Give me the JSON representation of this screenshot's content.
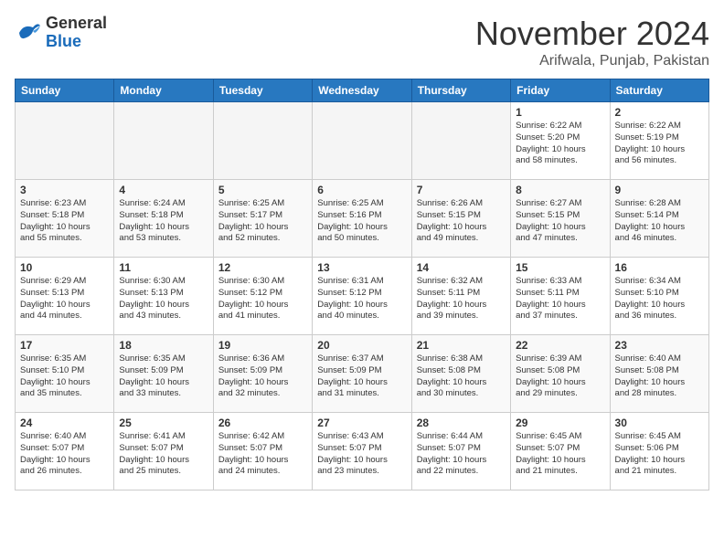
{
  "header": {
    "logo_general": "General",
    "logo_blue": "Blue",
    "month_year": "November 2024",
    "location": "Arifwala, Punjab, Pakistan"
  },
  "weekdays": [
    "Sunday",
    "Monday",
    "Tuesday",
    "Wednesday",
    "Thursday",
    "Friday",
    "Saturday"
  ],
  "weeks": [
    {
      "days": [
        {
          "num": "",
          "info": ""
        },
        {
          "num": "",
          "info": ""
        },
        {
          "num": "",
          "info": ""
        },
        {
          "num": "",
          "info": ""
        },
        {
          "num": "",
          "info": ""
        },
        {
          "num": "1",
          "info": "Sunrise: 6:22 AM\nSunset: 5:20 PM\nDaylight: 10 hours\nand 58 minutes."
        },
        {
          "num": "2",
          "info": "Sunrise: 6:22 AM\nSunset: 5:19 PM\nDaylight: 10 hours\nand 56 minutes."
        }
      ]
    },
    {
      "days": [
        {
          "num": "3",
          "info": "Sunrise: 6:23 AM\nSunset: 5:18 PM\nDaylight: 10 hours\nand 55 minutes."
        },
        {
          "num": "4",
          "info": "Sunrise: 6:24 AM\nSunset: 5:18 PM\nDaylight: 10 hours\nand 53 minutes."
        },
        {
          "num": "5",
          "info": "Sunrise: 6:25 AM\nSunset: 5:17 PM\nDaylight: 10 hours\nand 52 minutes."
        },
        {
          "num": "6",
          "info": "Sunrise: 6:25 AM\nSunset: 5:16 PM\nDaylight: 10 hours\nand 50 minutes."
        },
        {
          "num": "7",
          "info": "Sunrise: 6:26 AM\nSunset: 5:15 PM\nDaylight: 10 hours\nand 49 minutes."
        },
        {
          "num": "8",
          "info": "Sunrise: 6:27 AM\nSunset: 5:15 PM\nDaylight: 10 hours\nand 47 minutes."
        },
        {
          "num": "9",
          "info": "Sunrise: 6:28 AM\nSunset: 5:14 PM\nDaylight: 10 hours\nand 46 minutes."
        }
      ]
    },
    {
      "days": [
        {
          "num": "10",
          "info": "Sunrise: 6:29 AM\nSunset: 5:13 PM\nDaylight: 10 hours\nand 44 minutes."
        },
        {
          "num": "11",
          "info": "Sunrise: 6:30 AM\nSunset: 5:13 PM\nDaylight: 10 hours\nand 43 minutes."
        },
        {
          "num": "12",
          "info": "Sunrise: 6:30 AM\nSunset: 5:12 PM\nDaylight: 10 hours\nand 41 minutes."
        },
        {
          "num": "13",
          "info": "Sunrise: 6:31 AM\nSunset: 5:12 PM\nDaylight: 10 hours\nand 40 minutes."
        },
        {
          "num": "14",
          "info": "Sunrise: 6:32 AM\nSunset: 5:11 PM\nDaylight: 10 hours\nand 39 minutes."
        },
        {
          "num": "15",
          "info": "Sunrise: 6:33 AM\nSunset: 5:11 PM\nDaylight: 10 hours\nand 37 minutes."
        },
        {
          "num": "16",
          "info": "Sunrise: 6:34 AM\nSunset: 5:10 PM\nDaylight: 10 hours\nand 36 minutes."
        }
      ]
    },
    {
      "days": [
        {
          "num": "17",
          "info": "Sunrise: 6:35 AM\nSunset: 5:10 PM\nDaylight: 10 hours\nand 35 minutes."
        },
        {
          "num": "18",
          "info": "Sunrise: 6:35 AM\nSunset: 5:09 PM\nDaylight: 10 hours\nand 33 minutes."
        },
        {
          "num": "19",
          "info": "Sunrise: 6:36 AM\nSunset: 5:09 PM\nDaylight: 10 hours\nand 32 minutes."
        },
        {
          "num": "20",
          "info": "Sunrise: 6:37 AM\nSunset: 5:09 PM\nDaylight: 10 hours\nand 31 minutes."
        },
        {
          "num": "21",
          "info": "Sunrise: 6:38 AM\nSunset: 5:08 PM\nDaylight: 10 hours\nand 30 minutes."
        },
        {
          "num": "22",
          "info": "Sunrise: 6:39 AM\nSunset: 5:08 PM\nDaylight: 10 hours\nand 29 minutes."
        },
        {
          "num": "23",
          "info": "Sunrise: 6:40 AM\nSunset: 5:08 PM\nDaylight: 10 hours\nand 28 minutes."
        }
      ]
    },
    {
      "days": [
        {
          "num": "24",
          "info": "Sunrise: 6:40 AM\nSunset: 5:07 PM\nDaylight: 10 hours\nand 26 minutes."
        },
        {
          "num": "25",
          "info": "Sunrise: 6:41 AM\nSunset: 5:07 PM\nDaylight: 10 hours\nand 25 minutes."
        },
        {
          "num": "26",
          "info": "Sunrise: 6:42 AM\nSunset: 5:07 PM\nDaylight: 10 hours\nand 24 minutes."
        },
        {
          "num": "27",
          "info": "Sunrise: 6:43 AM\nSunset: 5:07 PM\nDaylight: 10 hours\nand 23 minutes."
        },
        {
          "num": "28",
          "info": "Sunrise: 6:44 AM\nSunset: 5:07 PM\nDaylight: 10 hours\nand 22 minutes."
        },
        {
          "num": "29",
          "info": "Sunrise: 6:45 AM\nSunset: 5:07 PM\nDaylight: 10 hours\nand 21 minutes."
        },
        {
          "num": "30",
          "info": "Sunrise: 6:45 AM\nSunset: 5:06 PM\nDaylight: 10 hours\nand 21 minutes."
        }
      ]
    }
  ]
}
